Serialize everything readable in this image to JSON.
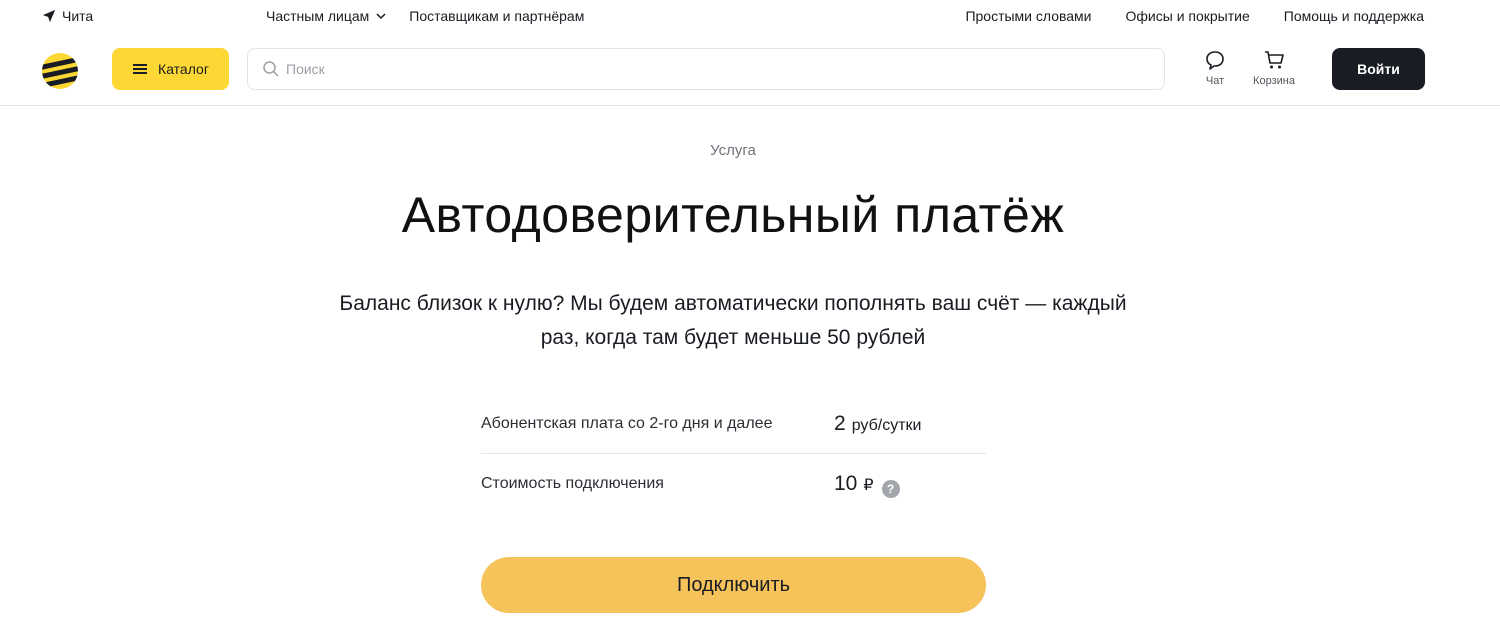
{
  "topbar": {
    "city": "Чита",
    "nav_left": [
      "Частным лицам",
      "Поставщикам и партнёрам"
    ],
    "nav_right": [
      "Простыми словами",
      "Офисы и покрытие",
      "Помощь и поддержка"
    ]
  },
  "header": {
    "catalog_label": "Каталог",
    "search_placeholder": "Поиск",
    "chat_label": "Чат",
    "cart_label": "Корзина",
    "login_label": "Войти"
  },
  "main": {
    "eyebrow": "Услуга",
    "title": "Автодоверительный платёж",
    "description": "Баланс близок к нулю? Мы будем автоматически пополнять ваш счёт — каждый раз, когда там будет меньше 50 рублей",
    "tariff": [
      {
        "label": "Абонентская плата со 2-го дня и далее",
        "value": "2",
        "unit": "руб/сутки"
      },
      {
        "label": "Стоимость подключения",
        "value": "10",
        "unit": "₽"
      }
    ],
    "help_glyph": "?",
    "connect_label": "Подключить"
  },
  "colors": {
    "brand_yellow": "#fdd835",
    "connect_button": "#f6c25a",
    "dark": "#191c22"
  }
}
